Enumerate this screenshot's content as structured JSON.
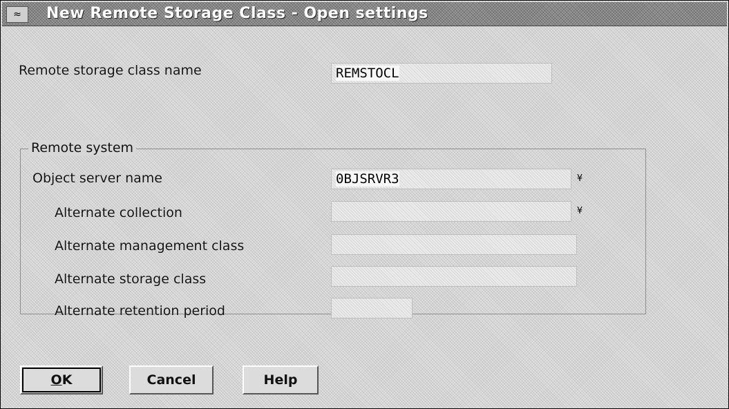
{
  "window": {
    "title": "New Remote Storage Class - Open settings",
    "sysmenu_icon": "≈"
  },
  "form": {
    "remote_storage_class_name_label": "Remote storage class name",
    "remote_storage_class_name_value": "REMSTOCL"
  },
  "remote_system": {
    "group_label": "Remote system",
    "object_server_name_label": "Object server name",
    "object_server_name_value": "0BJSRVR3",
    "alternate_collection_label": "Alternate collection",
    "alternate_collection_value": "",
    "alternate_management_class_label": "Alternate management class",
    "alternate_management_class_value": "",
    "alternate_storage_class_label": "Alternate storage class",
    "alternate_storage_class_value": "",
    "alternate_retention_period_label": "Alternate retention period",
    "alternate_retention_period_value": "",
    "dropdown_glyph": "¥"
  },
  "buttons": {
    "ok_label": "K",
    "ok_mnemonic": "O",
    "cancel_label": "Cancel",
    "help_label": "Help"
  }
}
